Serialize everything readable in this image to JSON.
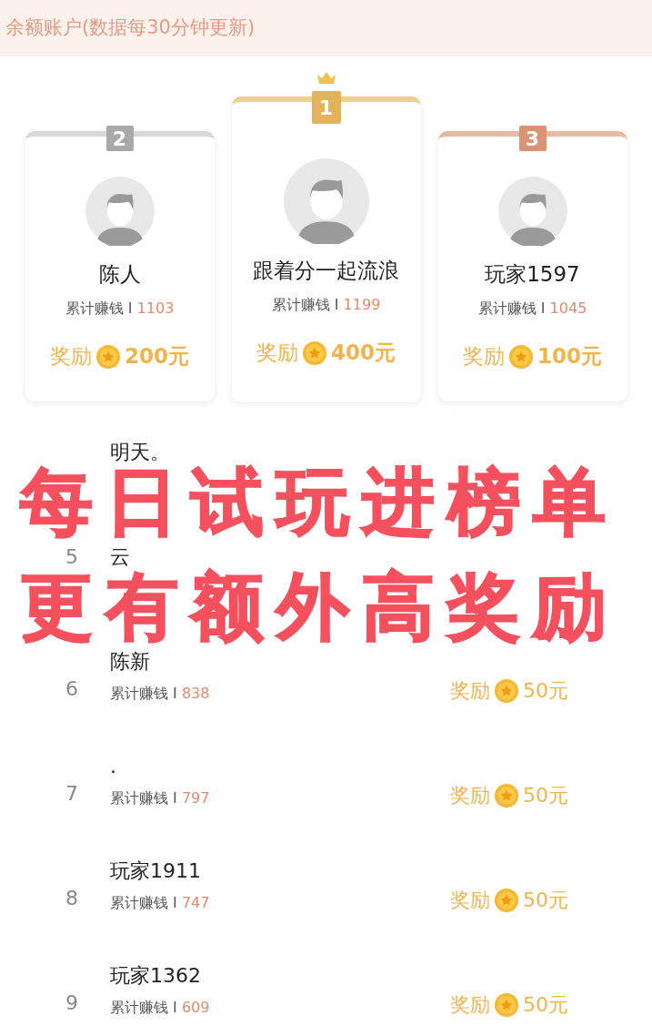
{
  "banner": {
    "text": "余额账户(数据每30分钟更新)"
  },
  "podium": [
    {
      "rank": "2",
      "kind": "silver",
      "name": "陈人",
      "earnings_label": "累计赚钱 I",
      "earnings": "1103",
      "reward_label": "奖励",
      "reward": "200元"
    },
    {
      "rank": "1",
      "kind": "gold",
      "name": "跟着分一起流浪",
      "earnings_label": "累计赚钱 I",
      "earnings": "1199",
      "reward_label": "奖励",
      "reward": "400元"
    },
    {
      "rank": "3",
      "kind": "bronze",
      "name": "玩家1597",
      "earnings_label": "累计赚钱 I",
      "earnings": "1045",
      "reward_label": "奖励",
      "reward": "100元"
    }
  ],
  "ranking": [
    {
      "name": "明天。"
    },
    {
      "rank": "5",
      "name": "云"
    },
    {
      "rank": "6",
      "name": "陈新",
      "earnings_label": "累计赚钱 I",
      "earnings": "838",
      "reward_label": "奖励",
      "reward": "50元"
    },
    {
      "rank": "7",
      "name": ".",
      "earnings_label": "累计赚钱 I",
      "earnings": "797",
      "reward_label": "奖励",
      "reward": "50元"
    },
    {
      "rank": "8",
      "name": "玩家1911",
      "earnings_label": "累计赚钱 I",
      "earnings": "747",
      "reward_label": "奖励",
      "reward": "50元"
    },
    {
      "rank": "9",
      "name": "玩家1362",
      "earnings_label": "累计赚钱 I",
      "earnings": "609",
      "reward_label": "奖励",
      "reward": "50元"
    }
  ],
  "promo_overlay": {
    "lines": [
      "每日试玩进榜单",
      "更有额外高奖励"
    ]
  }
}
